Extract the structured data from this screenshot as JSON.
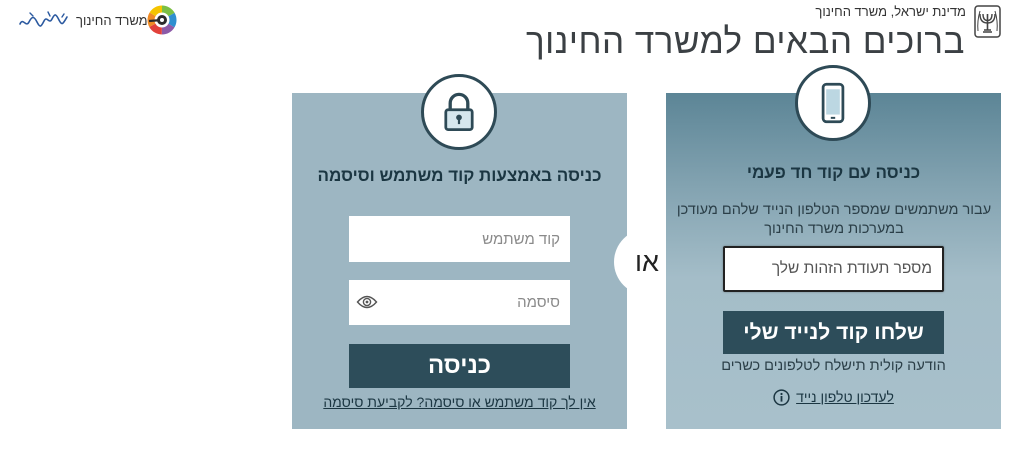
{
  "header": {
    "gov_label": "מדינת ישראל, משרד החינוך",
    "ministry_logo_label": "משרד החינוך",
    "title": "ברוכים הבאים למשרד החינוך"
  },
  "password_login": {
    "heading": "כניסה באמצעות קוד משתמש וסיסמה",
    "username_placeholder": "קוד משתמש",
    "username_value": "",
    "password_placeholder": "סיסמה",
    "password_value": "",
    "submit_label": "כניסה",
    "reset_link": "אין לך קוד משתמש או סיסמה? לקביעת סיסמה"
  },
  "divider": {
    "label": "או"
  },
  "otp_login": {
    "heading": "כניסה עם קוד חד פעמי",
    "description": "עבור משתמשים שמספר הטלפון הנייד שלהם מעודכן במערכות משרד החינוך",
    "id_placeholder": "מספר תעודת הזהות שלך",
    "id_value": "",
    "submit_label": "שלחו קוד לנייד שלי",
    "voice_note": "הודעה קולית תישלח לטלפונים כשרים",
    "update_phone_link": "לעדכון טלפון נייד"
  },
  "icons": {
    "emblem": "state-emblem-icon",
    "ministry_logo": "ministry-logo-icon",
    "lock": "lock-icon",
    "phone": "smartphone-icon",
    "eye": "eye-icon",
    "info": "info-icon"
  },
  "colors": {
    "panel": "#9db6c2",
    "panel_gradient_top": "#5c8596",
    "button": "#2d4d5a",
    "circle_border": "#2e4a56",
    "text_dark": "#1b3642"
  }
}
